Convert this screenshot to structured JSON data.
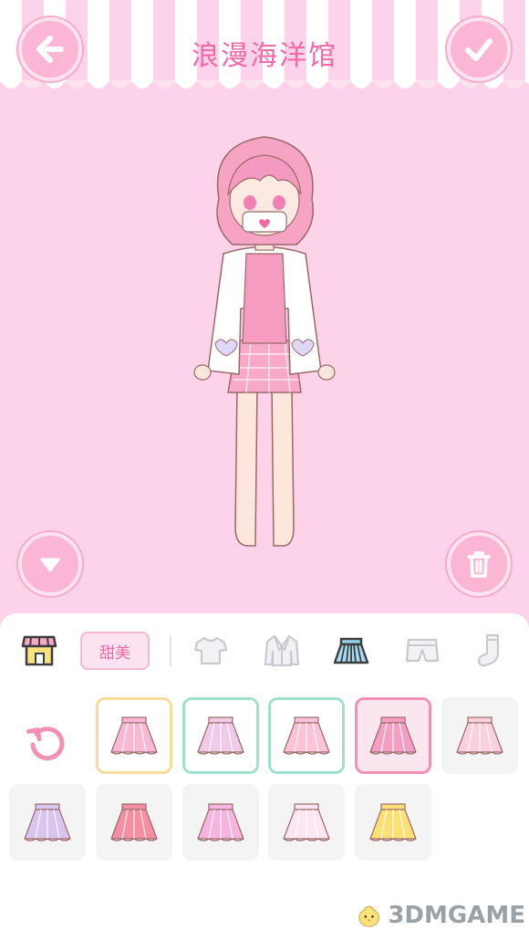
{
  "header": {
    "title": "浪漫海洋馆"
  },
  "icons": {
    "back": "arrow-left-icon",
    "confirm": "checkmark-icon",
    "collapse": "chevron-down-icon",
    "delete": "trash-icon",
    "shop": "shop-icon",
    "reset": "reset-icon"
  },
  "category_bar": {
    "style_label": "甜美",
    "tabs": [
      {
        "icon": "tshirt-icon",
        "selected": false
      },
      {
        "icon": "jacket-icon",
        "selected": false
      },
      {
        "icon": "skirt-icon",
        "selected": true
      },
      {
        "icon": "shorts-icon",
        "selected": false
      },
      {
        "icon": "sock-icon",
        "selected": false
      }
    ]
  },
  "items": [
    {
      "icon": "tutu-skirt-icon",
      "color": "#f9b8d3",
      "highlight": "yellow"
    },
    {
      "icon": "plaid-skirt-icon",
      "color": "#eecbe9",
      "highlight": "mint"
    },
    {
      "icon": "ruffle-skirt-icon",
      "color": "#fbc3d8",
      "highlight": "mint"
    },
    {
      "icon": "wrap-skirt-icon",
      "color": "#f39ec3",
      "highlight": "pink"
    },
    {
      "icon": "check-skirt-icon",
      "color": "#fbd0de",
      "highlight": "none"
    },
    {
      "icon": "lavender-pleat-skirt-icon",
      "color": "#d9c6ef",
      "highlight": "none"
    },
    {
      "icon": "polka-skirt-icon",
      "color": "#f48ea3",
      "highlight": "none"
    },
    {
      "icon": "bubble-skirt-icon",
      "color": "#f6b4e1",
      "highlight": "none"
    },
    {
      "icon": "lace-skirt-icon",
      "color": "#fde6f1",
      "highlight": "none"
    },
    {
      "icon": "yellow-skirt-icon",
      "color": "#fde073",
      "highlight": "none"
    }
  ],
  "watermark": {
    "text": "3DMGAME"
  },
  "colors": {
    "background": "#fdd3e9",
    "accent": "#f06aa7",
    "button": "#fbb6d6"
  }
}
